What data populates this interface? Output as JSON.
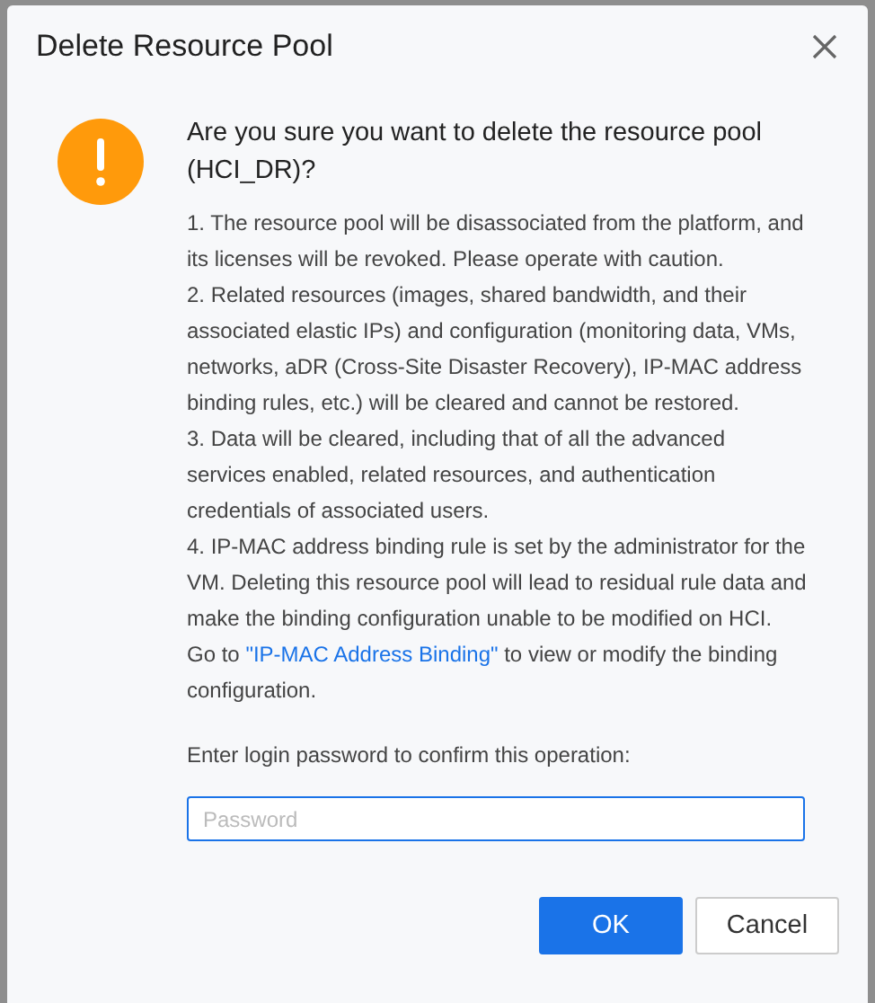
{
  "dialog": {
    "title": "Delete Resource Pool",
    "heading": "Are you sure you want to delete the resource pool (HCI_DR)?",
    "notes": [
      "1. The resource pool will be disassociated from the platform, and its licenses will be revoked. Please operate with caution.",
      "2. Related resources (images, shared bandwidth, and their associated elastic IPs) and configuration (monitoring data, VMs, networks, aDR (Cross-Site Disaster Recovery), IP-MAC address binding rules, etc.) will be cleared and cannot be restored.",
      "3. Data will be cleared, including that of all the advanced services enabled, related resources, and authentication credentials of associated users.",
      "4. IP-MAC address binding rule is set by the administrator for the VM. Deleting this resource pool will lead to residual rule data and make the binding configuration unable to be modified on HCI."
    ],
    "link_sentence": {
      "before": "Go to ",
      "link": "\"IP-MAC Address Binding\"",
      "after": " to view or modify the binding configuration."
    },
    "password": {
      "label": "Enter login password to confirm this operation:",
      "placeholder": "Password",
      "focused": true
    },
    "buttons": [
      {
        "label": "OK",
        "kind": "primary"
      },
      {
        "label": "Cancel",
        "kind": "secondary"
      }
    ]
  }
}
